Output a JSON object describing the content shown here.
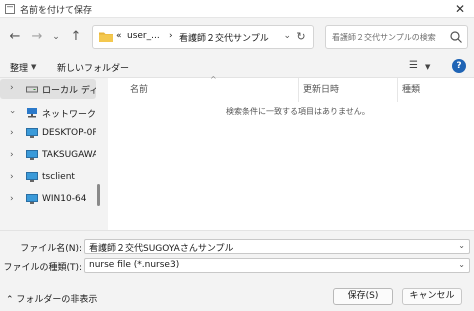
{
  "window": {
    "title": "名前を付けて保存"
  },
  "address": {
    "prefix": "«",
    "crumbs": [
      "user_...",
      "看護師２交代サンプル"
    ],
    "search_placeholder": "看護師２交代サンプルの検索"
  },
  "toolbar": {
    "organize": "整理",
    "new_folder": "新しいフォルダー"
  },
  "sidebar": {
    "items": [
      {
        "label": "ローカル ディスク"
      },
      {
        "label": "ネットワーク"
      },
      {
        "label": "DESKTOP-0PKV"
      },
      {
        "label": "TAKSUGAWARA"
      },
      {
        "label": "tsclient"
      },
      {
        "label": "WIN10-64"
      }
    ]
  },
  "filelist": {
    "columns": [
      "名前",
      "更新日時",
      "種類"
    ],
    "empty_message": "検索条件に一致する項目はありません。"
  },
  "form": {
    "filename_label": "ファイル名(N):",
    "filename_value": "看護師２交代SUGOYAさんサンプル",
    "filetype_label": "ファイルの種類(T):",
    "filetype_value": "nurse file (*.nurse3)"
  },
  "footer": {
    "hide_folders": "フォルダーの非表示",
    "save": "保存(S)",
    "cancel": "キャンセル"
  },
  "colors": {
    "accent": "#1f64b5",
    "folder": "#e8b53a"
  }
}
